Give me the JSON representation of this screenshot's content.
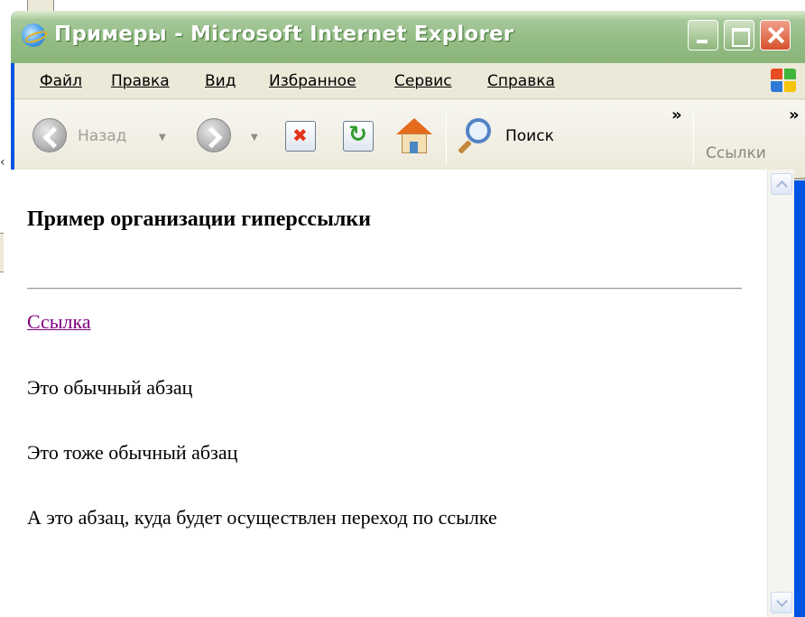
{
  "window": {
    "title": "Примеры - Microsoft Internet Explorer"
  },
  "menubar": {
    "items": [
      "Файл",
      "Правка",
      "Вид",
      "Избранное",
      "Сервис",
      "Справка"
    ]
  },
  "toolbar": {
    "back_label": "Назад",
    "search_label": "Поиск",
    "chevron": "»",
    "links_label": "Ссылки"
  },
  "page": {
    "heading": "Пример организации гиперссылки",
    "link_text": "Ссылка",
    "paragraphs": [
      "Это обычный абзац",
      "Это тоже обычный абзац",
      "А это абзац, куда будет осуществлен переход по ссылке"
    ]
  },
  "colors": {
    "titlebar": "#93bd84",
    "chrome": "#ece9d8",
    "visited_link": "#800080"
  },
  "icons": [
    "ie-icon",
    "minimize-icon",
    "maximize-icon",
    "close-icon",
    "windows-flag-icon",
    "back-icon",
    "forward-icon",
    "stop-icon",
    "refresh-icon",
    "home-icon",
    "search-icon"
  ]
}
